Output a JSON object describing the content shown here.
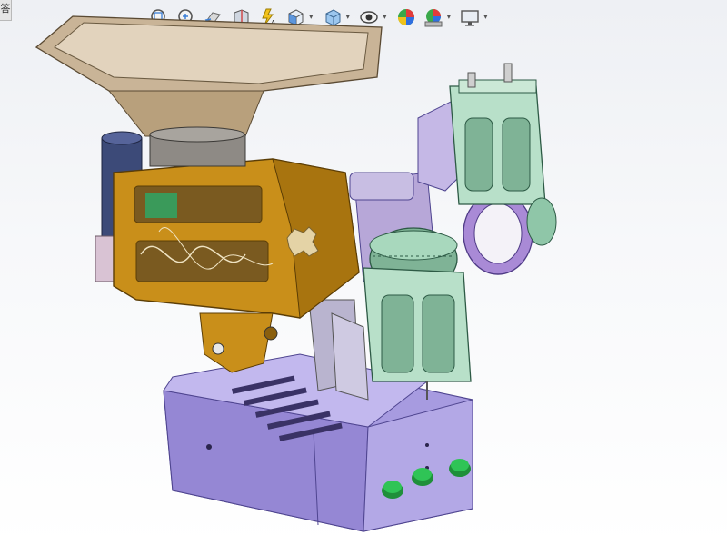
{
  "corner_tab": {
    "label": "答"
  },
  "heads_up_toolbar": {
    "items": [
      {
        "icon": "zoom-to-fit-icon",
        "has_dropdown": false
      },
      {
        "icon": "zoom-to-area-icon",
        "has_dropdown": false
      },
      {
        "icon": "previous-view-icon",
        "has_dropdown": false
      },
      {
        "icon": "section-view-icon",
        "has_dropdown": false
      },
      {
        "icon": "dynamic-annotation-view-icon",
        "has_dropdown": false
      },
      {
        "icon": "view-orientation-icon",
        "has_dropdown": true
      },
      {
        "icon": "display-style-icon",
        "has_dropdown": true
      },
      {
        "icon": "hide-show-items-icon",
        "has_dropdown": true
      },
      {
        "icon": "edit-appearance-icon",
        "has_dropdown": false
      },
      {
        "icon": "apply-scene-icon",
        "has_dropdown": true
      },
      {
        "icon": "view-settings-icon",
        "has_dropdown": true
      }
    ],
    "dropdown_glyph": "▾"
  },
  "model": {
    "description_icon": "3d-assembly-extruder-machine",
    "colors": {
      "hopper": "#d8c6ae",
      "hopper_rim": "#c9b497",
      "housing": "#c98f1a",
      "housing_dark": "#9a6a0f",
      "base": "#a79be0",
      "base_dark": "#7d70c4",
      "roller_frame": "#b8e0c9",
      "roller": "#8fc6a8",
      "purple_part": "#a98ad6",
      "knob": "#e4d3a6",
      "green_button": "#27b04a",
      "motor": "#3c4a78",
      "spring": "#d7d2ea"
    }
  }
}
